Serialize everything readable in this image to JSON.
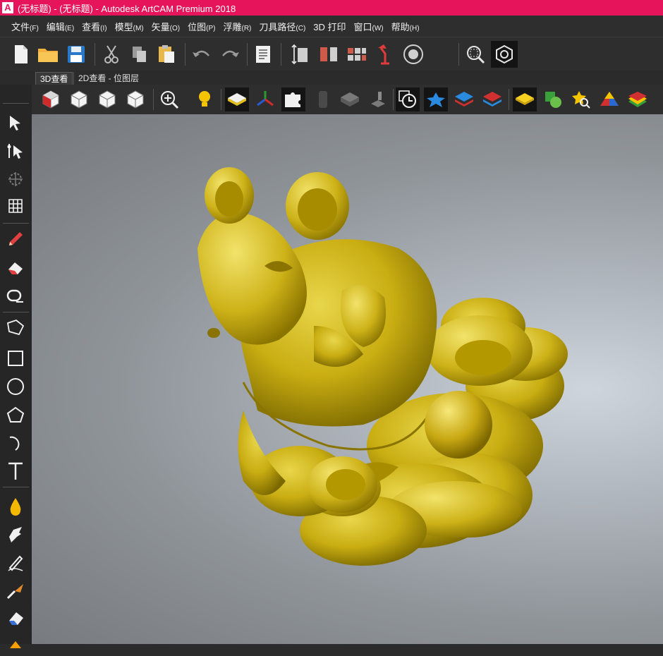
{
  "window": {
    "title": "(无标题) - (无标题) - Autodesk ArtCAM Premium 2018",
    "logo_letter": "A"
  },
  "menu": [
    {
      "label": "文件",
      "key": "(F)"
    },
    {
      "label": "编辑",
      "key": "(E)"
    },
    {
      "label": "查看",
      "key": "(I)"
    },
    {
      "label": "模型",
      "key": "(M)"
    },
    {
      "label": "矢量",
      "key": "(O)"
    },
    {
      "label": "位图",
      "key": "(P)"
    },
    {
      "label": "浮雕",
      "key": "(R)"
    },
    {
      "label": "刀具路径",
      "key": "(C)"
    },
    {
      "label": "3D 打印",
      "key": ""
    },
    {
      "label": "窗口",
      "key": "(W)"
    },
    {
      "label": "帮助",
      "key": "(H)"
    }
  ],
  "tabs": {
    "active": "3D查看",
    "inactive": "2D查看 - 位图层"
  },
  "toolbar_icons": [
    "new-file-icon",
    "open-folder-icon",
    "save-icon",
    "cut-icon",
    "copy-icon",
    "paste-icon",
    "undo-icon",
    "redo-icon",
    "notes-icon",
    "model-size-icon",
    "mirror-icon",
    "tile-icon",
    "lamp-icon",
    "show-tools-icon",
    "zoom-window-icon",
    "render-icon"
  ],
  "viewbar_icons": [
    "view-iso-icon",
    "view-top-icon",
    "view-front-icon",
    "view-right-icon",
    "zoom-icon",
    "light-icon",
    "relief-display-icon",
    "axes-icon",
    "puzzle-icon",
    "block-icon",
    "flat-shade-icon",
    "machine-icon",
    "clock-icon",
    "star-icon",
    "layers-blue-icon",
    "layers-red-icon",
    "layer-yellow-icon",
    "shapes-icon",
    "star-search-icon",
    "pyramid-icon",
    "rainbow-icon"
  ],
  "leftbar_icons": [
    "select-arrow-icon",
    "node-edit-icon",
    "transform-icon",
    "grid-icon",
    "pencil-icon",
    "eraser-red-icon",
    "measure-icon",
    "polyline-icon",
    "rectangle-icon",
    "circle-icon",
    "polygon-icon",
    "arc-icon",
    "text-icon",
    "fill-icon",
    "smooth-hand-icon",
    "sculpt-icon",
    "knife-icon",
    "erase-icon"
  ],
  "colors": {
    "titlebar": "#e6145a",
    "model_gold": "#d4bc1c"
  }
}
